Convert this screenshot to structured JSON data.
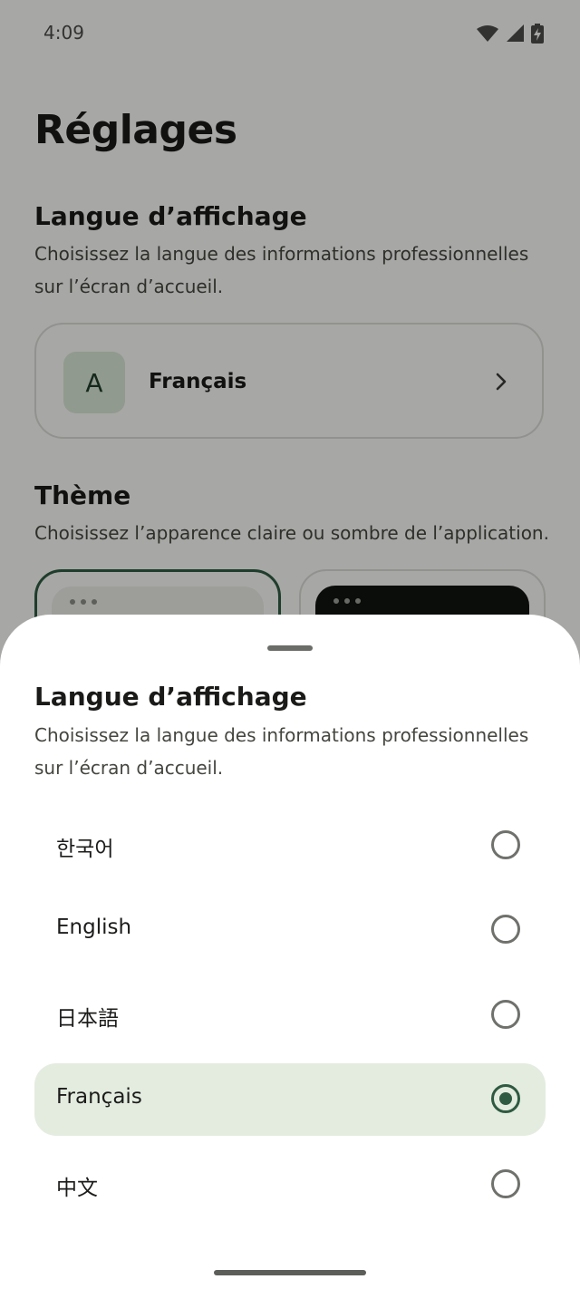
{
  "status_bar": {
    "time": "4:09",
    "icons": [
      "wifi-icon",
      "signal-icon",
      "battery-charging-icon"
    ]
  },
  "page": {
    "title": "Réglages"
  },
  "language_section": {
    "title": "Langue d’affichage",
    "description": "Choisissez la langue des informations professionnelles sur l’écran d’accueil.",
    "card": {
      "avatar_letter": "A",
      "current_language": "Français"
    }
  },
  "theme_section": {
    "title": "Thème",
    "description": "Choisissez l’apparence claire ou sombre de l’application.",
    "options": [
      "light",
      "dark"
    ],
    "selected": "light"
  },
  "sheet": {
    "title": "Langue d’affichage",
    "description": "Choisissez la langue des informations professionnelles sur l’écran d’accueil.",
    "options": [
      {
        "label": "한국어",
        "selected": false
      },
      {
        "label": "English",
        "selected": false
      },
      {
        "label": "日本語",
        "selected": false
      },
      {
        "label": "Français",
        "selected": true
      },
      {
        "label": "中文",
        "selected": false
      }
    ]
  },
  "colors": {
    "accent": "#2e5a41",
    "selected_bg": "#e4ece0",
    "avatar_bg": "#d5e3d2"
  }
}
